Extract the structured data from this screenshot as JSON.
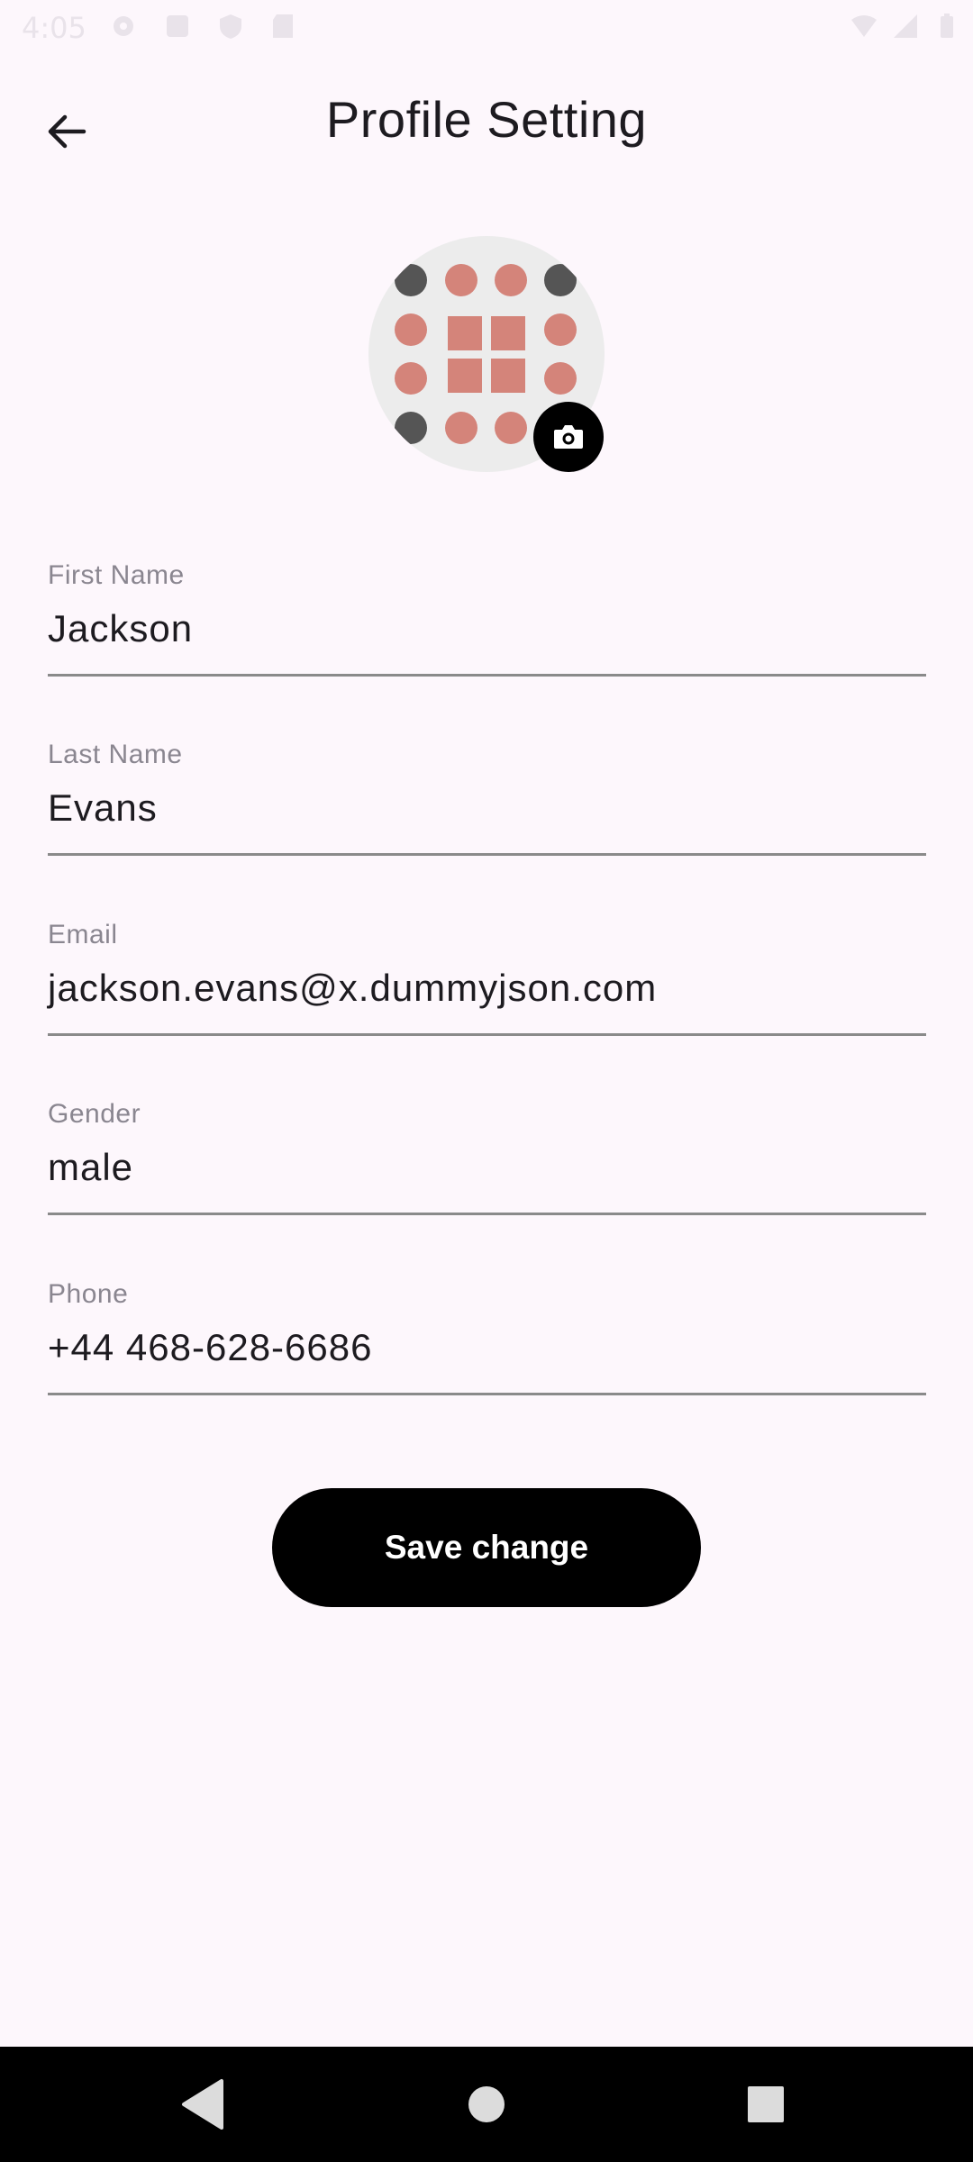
{
  "status_bar": {
    "time": "4:05",
    "icons": [
      "settings-icon",
      "a-icon",
      "shield-icon",
      "sd-card-icon",
      "wifi-icon",
      "signal-icon",
      "battery-icon"
    ]
  },
  "header": {
    "title": "Profile Setting",
    "back_icon": "arrow-back-icon"
  },
  "avatar": {
    "camera_icon": "camera-icon"
  },
  "form": {
    "first_name": {
      "label": "First Name",
      "value": "Jackson"
    },
    "last_name": {
      "label": "Last Name",
      "value": "Evans"
    },
    "email": {
      "label": "Email",
      "value": "jackson.evans@x.dummyjson.com"
    },
    "gender": {
      "label": "Gender",
      "value": "male"
    },
    "phone": {
      "label": "Phone",
      "value": "+44 468-628-6686"
    }
  },
  "actions": {
    "save_label": "Save change"
  },
  "nav_bar": {
    "buttons": [
      "back-triangle-icon",
      "home-circle-icon",
      "recents-square-icon"
    ]
  },
  "colors": {
    "background": "#fdf7fc",
    "primary": "#000000",
    "avatar_pink": "#d4847a",
    "avatar_dark": "#555555"
  }
}
